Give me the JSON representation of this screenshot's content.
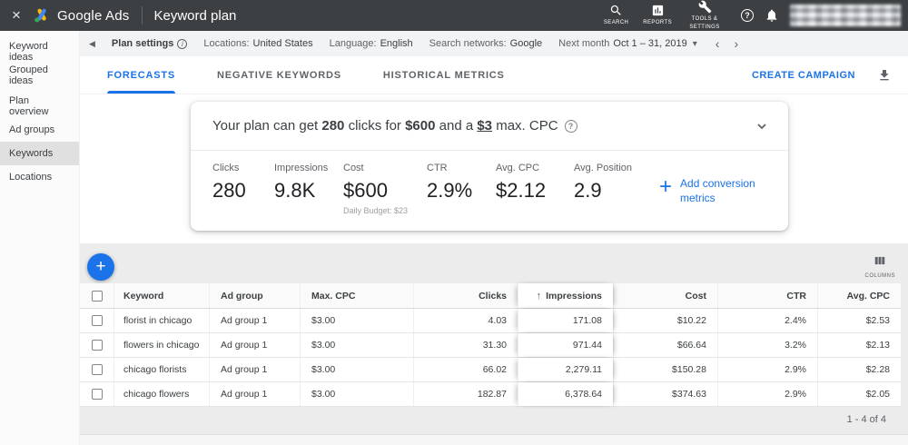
{
  "icons": {
    "close": "×",
    "back": "◀",
    "caret_down": "▾",
    "chevron_left": "‹",
    "chevron_right": "›",
    "sort_up": "↑",
    "plus": "+",
    "help": "?",
    "info": "i"
  },
  "colors": {
    "accent_blue": "#1a73e8",
    "topbar_bg": "#3c4043"
  },
  "topbar": {
    "brand": "Google Ads",
    "title": "Keyword plan",
    "search_label": "SEARCH",
    "reports_label": "REPORTS",
    "tools_label": "TOOLS & SETTINGS"
  },
  "sidebar": {
    "items": [
      {
        "label": "Keyword ideas"
      },
      {
        "label": "Grouped ideas"
      },
      {
        "label": "Plan overview"
      },
      {
        "label": "Ad groups"
      },
      {
        "label": "Keywords"
      },
      {
        "label": "Locations"
      }
    ]
  },
  "settings": {
    "plan_settings": "Plan settings",
    "locations_label": "Locations:",
    "locations_value": "United States",
    "language_label": "Language:",
    "language_value": "English",
    "networks_label": "Search networks:",
    "networks_value": "Google",
    "period_label": "Next month",
    "period_value": "Oct 1 – 31, 2019"
  },
  "tabs": {
    "forecasts": "FORECASTS",
    "negative": "NEGATIVE KEYWORDS",
    "historical": "HISTORICAL METRICS",
    "create_campaign": "CREATE CAMPAIGN"
  },
  "summary": {
    "headline": {
      "p1": "Your plan can get ",
      "clicks": "280",
      "p2": " clicks for ",
      "cost": "$600",
      "p3": " and a ",
      "cpc": "$3",
      "p4": " max. CPC"
    },
    "metrics": [
      {
        "label": "Clicks",
        "value": "280"
      },
      {
        "label": "Impressions",
        "value": "9.8K"
      },
      {
        "label": "Cost",
        "value": "$600",
        "sub": "Daily Budget: $23"
      },
      {
        "label": "CTR",
        "value": "2.9%"
      },
      {
        "label": "Avg. CPC",
        "value": "$2.12"
      },
      {
        "label": "Avg. Position",
        "value": "2.9"
      }
    ],
    "add_conversion_line1": "Add conversion",
    "add_conversion_line2": "metrics"
  },
  "table": {
    "columns_label": "COLUMNS",
    "headers": {
      "keyword": "Keyword",
      "ad_group": "Ad group",
      "max_cpc": "Max. CPC",
      "clicks": "Clicks",
      "impressions": "Impressions",
      "cost": "Cost",
      "ctr": "CTR",
      "avg_cpc": "Avg. CPC"
    },
    "rows": [
      {
        "keyword": "florist in chicago",
        "ad_group": "Ad group 1",
        "max_cpc": "$3.00",
        "clicks": "4.03",
        "impressions": "171.08",
        "cost": "$10.22",
        "ctr": "2.4%",
        "avg_cpc": "$2.53"
      },
      {
        "keyword": "flowers in chicago",
        "ad_group": "Ad group 1",
        "max_cpc": "$3.00",
        "clicks": "31.30",
        "impressions": "971.44",
        "cost": "$66.64",
        "ctr": "3.2%",
        "avg_cpc": "$2.13"
      },
      {
        "keyword": "chicago florists",
        "ad_group": "Ad group 1",
        "max_cpc": "$3.00",
        "clicks": "66.02",
        "impressions": "2,279.11",
        "cost": "$150.28",
        "ctr": "2.9%",
        "avg_cpc": "$2.28"
      },
      {
        "keyword": "chicago flowers",
        "ad_group": "Ad group 1",
        "max_cpc": "$3.00",
        "clicks": "182.87",
        "impressions": "6,378.64",
        "cost": "$374.63",
        "ctr": "2.9%",
        "avg_cpc": "$2.05"
      }
    ],
    "pagination": "1 - 4 of 4"
  }
}
